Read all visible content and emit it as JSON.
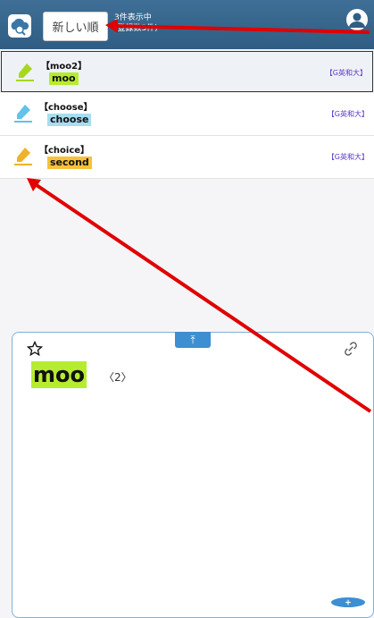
{
  "header": {
    "sort_label": "新しい順",
    "count_line1": "3件表示中",
    "count_line2": "(登録数3件)"
  },
  "items": [
    {
      "title": "【moo2】",
      "word": "moo",
      "tag": "【G英和大】",
      "highlight": "#b6ec2f",
      "pen_color": "#a6d81e"
    },
    {
      "title": "【choose】",
      "word": "choose",
      "tag": "【G英和大】",
      "highlight": "#a9dcf0",
      "pen_color": "#62c3e8"
    },
    {
      "title": "【choice】",
      "word": "second",
      "tag": "【G英和大】",
      "highlight": "#f7c23a",
      "pen_color": "#f0b22a"
    }
  ],
  "detail": {
    "headword": "moo",
    "sense": "〈2〉",
    "expand_glyph": "⤒"
  },
  "colors": {
    "accent": "#3d8fd1",
    "header": "#2f5d83",
    "arrow": "#e00000"
  }
}
